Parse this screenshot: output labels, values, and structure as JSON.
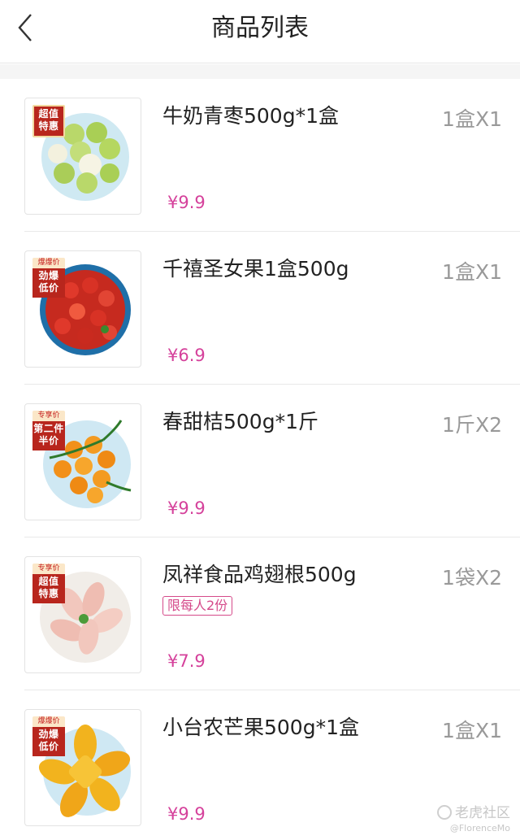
{
  "header": {
    "title": "商品列表",
    "back_icon": "chevron-left-icon"
  },
  "products": [
    {
      "name": "牛奶青枣500g*1盒",
      "qty": "1盒X1",
      "price": "¥9.9",
      "limit": "",
      "badge": {
        "top": "",
        "lines": [
          "超值",
          "特惠"
        ]
      },
      "image": "green-jujube"
    },
    {
      "name": "千禧圣女果1盒500g",
      "qty": "1盒X1",
      "price": "¥6.9",
      "limit": "",
      "badge": {
        "top": "爆爆价",
        "lines": [
          "劲爆",
          "低价"
        ]
      },
      "image": "cherry-tomato"
    },
    {
      "name": "春甜桔500g*1斤",
      "qty": "1斤X2",
      "price": "¥9.9",
      "limit": "",
      "badge": {
        "top": "专享价",
        "lines": [
          "第二件",
          "半价"
        ]
      },
      "image": "tangerine"
    },
    {
      "name": "凤祥食品鸡翅根500g",
      "qty": "1袋X2",
      "price": "¥7.9",
      "limit": "限每人2份",
      "badge": {
        "top": "专享价",
        "lines": [
          "超值",
          "特惠"
        ]
      },
      "image": "chicken-drumette"
    },
    {
      "name": "小台农芒果500g*1盒",
      "qty": "1盒X1",
      "price": "¥9.9",
      "limit": "",
      "badge": {
        "top": "爆爆价",
        "lines": [
          "劲爆",
          "低价"
        ]
      },
      "image": "mango"
    }
  ],
  "watermark": {
    "text": "老虎社区",
    "sub": "@FlorenceMo"
  },
  "colors": {
    "price": "#d5419b",
    "badge": "#b8261d",
    "qty": "#999999"
  }
}
